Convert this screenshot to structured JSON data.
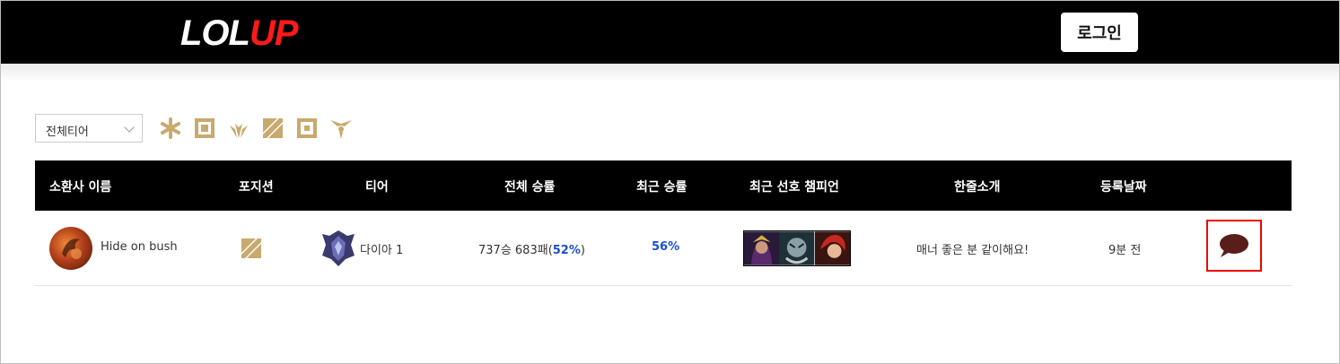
{
  "header": {
    "logo_part1": "LOL",
    "logo_part2": "UP",
    "login_label": "로그인"
  },
  "filters": {
    "tier_select_value": "전체티어",
    "tier_icons": [
      "challenger-icon",
      "grandmaster-icon",
      "master-icon",
      "diamond-icon",
      "platinum-icon",
      "gold-icon"
    ],
    "icon_color": "#c8aa6e"
  },
  "table": {
    "columns": [
      "소환사 이름",
      "포지션",
      "티어",
      "전체 승률",
      "최근 승률",
      "최근 선호 챔피언",
      "한줄소개",
      "등록날짜"
    ],
    "rows": [
      {
        "summoner": "Hide on bush",
        "position_icon": "mid-lane-icon",
        "tier": "다이아 1",
        "record": "737승 683패",
        "winrate_open": "(",
        "winrate": "52%",
        "winrate_close": ")",
        "recent_winrate": "56%",
        "champions": [
          "champion-1-portrait",
          "champion-2-portrait",
          "champion-3-portrait"
        ],
        "intro": "매너 좋은 분 같이해요!",
        "registered": "9분 전"
      }
    ]
  },
  "colors": {
    "accent_blue": "#1a4fd6",
    "logo_red": "#ff1a1a",
    "highlight_red": "#ee0000",
    "chat_icon": "#5a1e1a"
  }
}
